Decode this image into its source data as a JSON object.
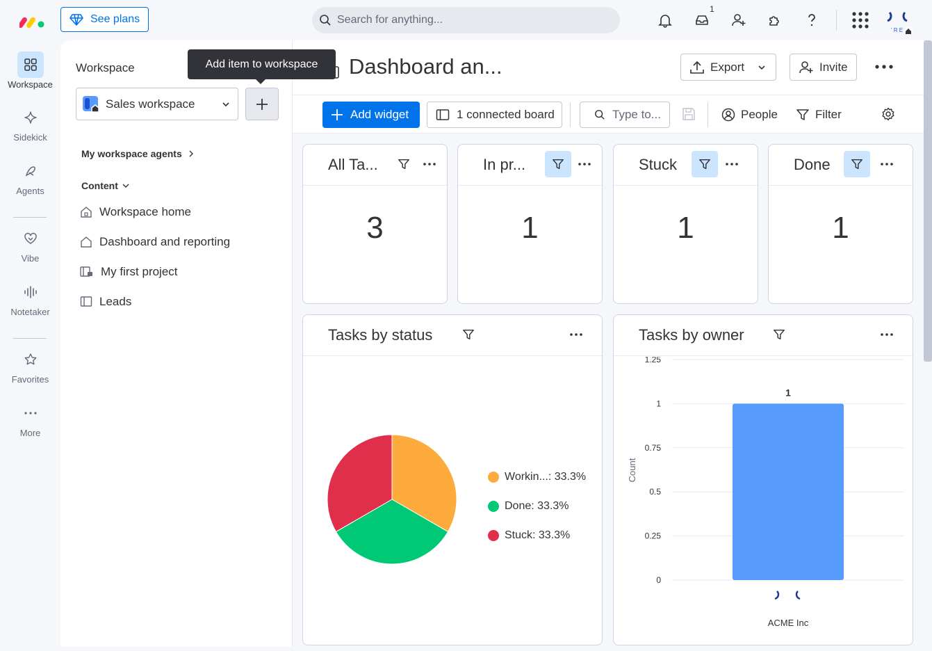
{
  "topbar": {
    "see_plans": "See plans",
    "search_placeholder": "Search for anything...",
    "inbox_badge": "1"
  },
  "rail": {
    "items": [
      {
        "label": "Workspace",
        "icon": "grid-icon"
      },
      {
        "label": "Sidekick",
        "icon": "sparkle-icon"
      },
      {
        "label": "Agents",
        "icon": "agents-icon"
      },
      {
        "label": "Vibe",
        "icon": "heart-icon"
      },
      {
        "label": "Notetaker",
        "icon": "audio-wave-icon"
      },
      {
        "label": "Favorites",
        "icon": "star-icon"
      },
      {
        "label": "More",
        "icon": "dots-icon"
      }
    ]
  },
  "workspace_panel": {
    "title": "Workspace",
    "workspace_name": "Sales workspace",
    "tooltip": "Add item to workspace",
    "agents_link": "My workspace agents",
    "content_label": "Content",
    "nav": [
      {
        "label": "Workspace home",
        "icon": "home-lock-icon"
      },
      {
        "label": "Dashboard and reporting",
        "icon": "home-icon"
      },
      {
        "label": "My first project",
        "icon": "board-lock-icon"
      },
      {
        "label": "Leads",
        "icon": "board-icon"
      }
    ]
  },
  "main": {
    "title": "Dashboard an...",
    "export": "Export",
    "invite": "Invite",
    "toolbar": {
      "add_widget": "Add widget",
      "connected_board": "1 connected board",
      "type_placeholder": "Type to...",
      "people": "People",
      "filter": "Filter"
    },
    "number_widgets": [
      {
        "title": "All Ta...",
        "value": "3",
        "filter_active": false
      },
      {
        "title": "In pr...",
        "value": "1",
        "filter_active": true
      },
      {
        "title": "Stuck",
        "value": "1",
        "filter_active": true
      },
      {
        "title": "Done",
        "value": "1",
        "filter_active": true
      }
    ],
    "status_widget": {
      "title": "Tasks by status",
      "legend": [
        {
          "label": "Workin...: 33.3%",
          "color": "#fdab3d"
        },
        {
          "label": "Done: 33.3%",
          "color": "#00c875"
        },
        {
          "label": "Stuck: 33.3%",
          "color": "#df2f4a"
        }
      ]
    },
    "owner_widget": {
      "title": "Tasks by owner"
    }
  },
  "chart_data": [
    {
      "type": "pie",
      "title": "Tasks by status",
      "slices": [
        {
          "label": "Workin...",
          "value": 33.3,
          "color": "#fdab3d"
        },
        {
          "label": "Done",
          "value": 33.3,
          "color": "#00c875"
        },
        {
          "label": "Stuck",
          "value": 33.3,
          "color": "#df2f4a"
        }
      ]
    },
    {
      "type": "bar",
      "title": "Tasks by owner",
      "categories": [
        "ACME Inc"
      ],
      "values": [
        1
      ],
      "data_labels": [
        "1"
      ],
      "ylabel": "Count",
      "ylim": [
        0,
        1.25
      ],
      "yticks": [
        "0",
        "0.25",
        "0.5",
        "0.75",
        "1",
        "1.25"
      ],
      "bar_color": "#579bfc",
      "grid": true
    }
  ]
}
